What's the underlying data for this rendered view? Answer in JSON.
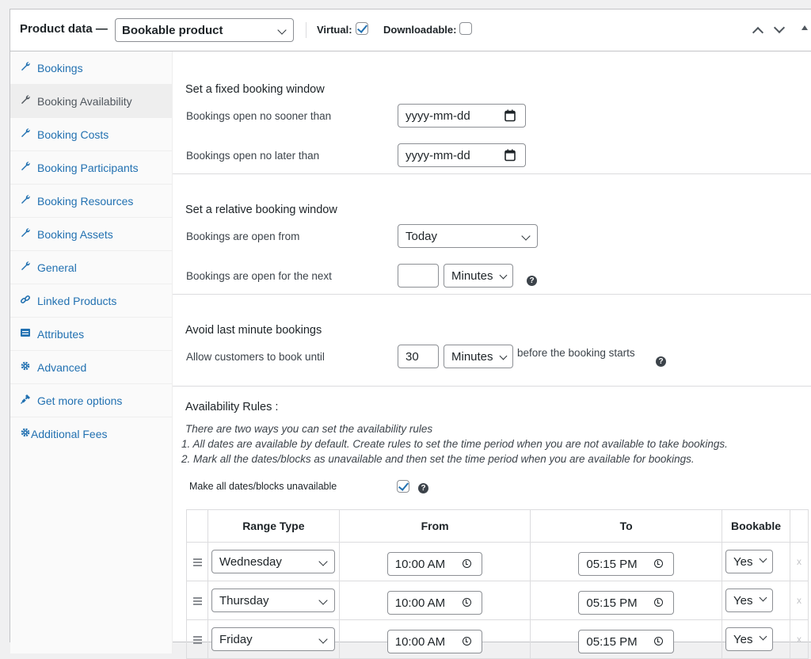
{
  "header": {
    "title": "Product data —",
    "product_type": "Bookable product",
    "virtual_label": "Virtual:",
    "virtual_checked": true,
    "downloadable_label": "Downloadable:",
    "downloadable_checked": false
  },
  "sidebar": {
    "items": [
      {
        "label": "Bookings",
        "icon": "wrench-icon",
        "active": false
      },
      {
        "label": "Booking Availability",
        "icon": "wrench-icon",
        "active": true
      },
      {
        "label": "Booking Costs",
        "icon": "wrench-icon",
        "active": false
      },
      {
        "label": "Booking Participants",
        "icon": "wrench-icon",
        "active": false
      },
      {
        "label": "Booking Resources",
        "icon": "wrench-icon",
        "active": false
      },
      {
        "label": "Booking Assets",
        "icon": "wrench-icon",
        "active": false
      },
      {
        "label": "General",
        "icon": "wrench-icon",
        "active": false
      },
      {
        "label": "Linked Products",
        "icon": "link-icon",
        "active": false
      },
      {
        "label": "Attributes",
        "icon": "list-icon",
        "active": false
      },
      {
        "label": "Advanced",
        "icon": "gear-icon",
        "active": false
      },
      {
        "label": "Get more options",
        "icon": "plug-icon",
        "active": false
      },
      {
        "label": "Additional Fees",
        "icon": "gear-icon",
        "active": false
      }
    ]
  },
  "fixed_window": {
    "title": "Set a fixed booking window",
    "open_no_sooner_label": "Bookings open no sooner than",
    "open_no_sooner_placeholder": "yyyy-mm-dd",
    "open_no_later_label": "Bookings open no later than",
    "open_no_later_placeholder": "yyyy-mm-dd"
  },
  "relative_window": {
    "title": "Set a relative booking window",
    "open_from_label": "Bookings are open from",
    "open_from_value": "Today",
    "open_next_label": "Bookings are open for the next",
    "open_next_value": "",
    "open_next_unit": "Minutes"
  },
  "last_minute": {
    "title": "Avoid last minute bookings",
    "allow_until_label": "Allow customers to book until",
    "allow_until_value": "30",
    "allow_until_unit": "Minutes",
    "suffix": "before the booking starts"
  },
  "availability": {
    "title": "Availability Rules :",
    "note_line1": "There are two ways you can set the availability rules",
    "note_line2": "1. All dates are available by default. Create rules to set the time period when you are not available to take bookings.",
    "note_line3": "2. Mark all the dates/blocks as unavailable and then set the time period when you are available for bookings.",
    "make_unavailable_label": "Make all dates/blocks unavailable",
    "make_unavailable_checked": true
  },
  "rules_table": {
    "columns": [
      "Range Type",
      "From",
      "To",
      "Bookable"
    ],
    "rows": [
      {
        "range_type": "Wednesday",
        "from": "10:00 AM",
        "to": "05:15 PM",
        "bookable": "Yes",
        "delete": "x"
      },
      {
        "range_type": "Thursday",
        "from": "10:00 AM",
        "to": "05:15 PM",
        "bookable": "Yes",
        "delete": "x"
      },
      {
        "range_type": "Friday",
        "from": "10:00 AM",
        "to": "05:15 PM",
        "bookable": "Yes",
        "delete": "x"
      }
    ]
  },
  "colors": {
    "link": "#2271b1",
    "border": "#c3c4c7",
    "sidebar_bg": "#fafafa",
    "active_bg": "#eeeeee"
  }
}
